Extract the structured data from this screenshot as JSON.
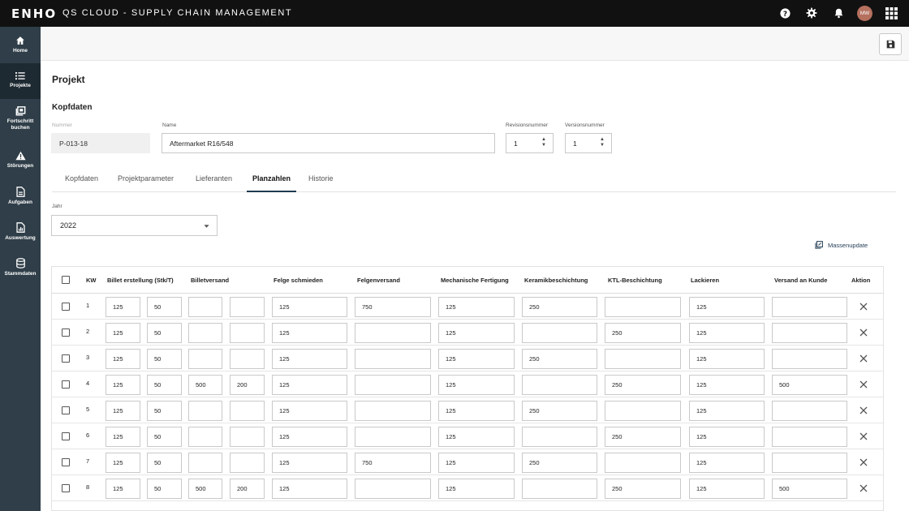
{
  "app": {
    "logo": "ENHO",
    "title": "QS CLOUD - SUPPLY CHAIN MANAGEMENT",
    "user_initials": "MW"
  },
  "top_icons": [
    "help-icon",
    "gear-icon",
    "bell-icon",
    "apps-grid-icon"
  ],
  "sidebar": {
    "items": [
      {
        "label": "Home",
        "icon": "home-icon",
        "active": false
      },
      {
        "label": "Projekte",
        "icon": "list-icon",
        "active": true
      },
      {
        "label": "Fortschritt buchen",
        "icon": "book-progress-icon",
        "active": false
      },
      {
        "label": "Störungen",
        "icon": "warning-icon",
        "active": false
      },
      {
        "label": "Aufgaben",
        "icon": "task-icon",
        "active": false
      },
      {
        "label": "Auswertung",
        "icon": "chart-icon",
        "active": false
      },
      {
        "label": "Stammdaten",
        "icon": "database-icon",
        "active": false
      }
    ]
  },
  "page": {
    "title": "Projekt",
    "section": "Kopfdaten"
  },
  "form": {
    "nummer": {
      "label": "Nummer",
      "value": "P-013-18"
    },
    "name": {
      "label": "Name",
      "value": "Aftermarket R16/548"
    },
    "revision": {
      "label": "Revisionsnummer",
      "value": "1"
    },
    "version": {
      "label": "Versionsnummer",
      "value": "1"
    }
  },
  "tabs": [
    {
      "label": "Kopfdaten",
      "active": false
    },
    {
      "label": "Projektparameter",
      "active": false
    },
    {
      "label": "Lieferanten",
      "active": false
    },
    {
      "label": "Planzahlen",
      "active": true
    },
    {
      "label": "Historie",
      "active": false
    }
  ],
  "year": {
    "label": "Jahr",
    "value": "2022"
  },
  "mass_update_label": "Massenupdate",
  "table": {
    "headers": {
      "kw": "KW",
      "billet_erstellung": "Billet erstellung (Stk/T)",
      "billetversand": "Billetversand",
      "felge_schmieden": "Felge schmieden",
      "felgenversand": "Felgenversand",
      "mechanische_fertigung": "Mechanische Fertigung",
      "keramikbeschichtung": "Keramikbeschichtung",
      "ktl_beschichtung": "KTL-Beschichtung",
      "lackieren": "Lackieren",
      "versand_an_kunde": "Versand an Kunde",
      "aktion": "Aktion"
    },
    "rows": [
      {
        "kw": "1",
        "c": [
          "125",
          "50",
          "",
          "",
          "125",
          "750",
          "125",
          "250",
          "",
          "125",
          ""
        ]
      },
      {
        "kw": "2",
        "c": [
          "125",
          "50",
          "",
          "",
          "125",
          "",
          "125",
          "",
          "250",
          "125",
          ""
        ]
      },
      {
        "kw": "3",
        "c": [
          "125",
          "50",
          "",
          "",
          "125",
          "",
          "125",
          "250",
          "",
          "125",
          ""
        ]
      },
      {
        "kw": "4",
        "c": [
          "125",
          "50",
          "500",
          "200",
          "125",
          "",
          "125",
          "",
          "250",
          "125",
          "500"
        ]
      },
      {
        "kw": "5",
        "c": [
          "125",
          "50",
          "",
          "",
          "125",
          "",
          "125",
          "250",
          "",
          "125",
          ""
        ]
      },
      {
        "kw": "6",
        "c": [
          "125",
          "50",
          "",
          "",
          "125",
          "",
          "125",
          "",
          "250",
          "125",
          ""
        ]
      },
      {
        "kw": "7",
        "c": [
          "125",
          "50",
          "",
          "",
          "125",
          "750",
          "125",
          "250",
          "",
          "125",
          ""
        ]
      },
      {
        "kw": "8",
        "c": [
          "125",
          "50",
          "500",
          "200",
          "125",
          "",
          "125",
          "",
          "250",
          "125",
          "500"
        ]
      }
    ]
  },
  "colors": {
    "topbar": "#111111",
    "sidebar": "#2f3e48",
    "sidebar_active": "#1e2a32",
    "accent": "#1f3a52"
  }
}
